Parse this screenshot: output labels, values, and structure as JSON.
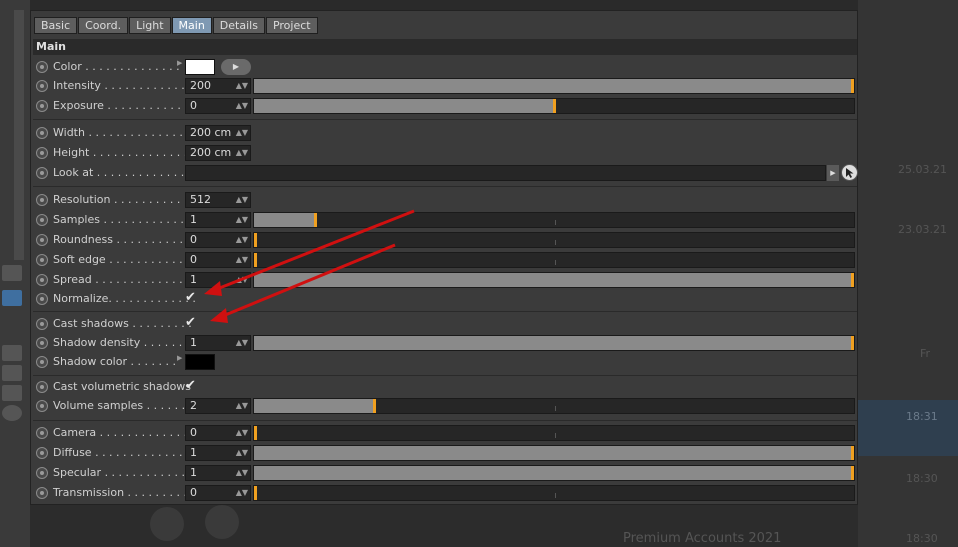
{
  "tabs": [
    "Basic",
    "Coord.",
    "Light",
    "Main",
    "Details",
    "Project"
  ],
  "active_tab": "Main",
  "section_title": "Main",
  "rows": {
    "color": {
      "label": "Color . . . . . . . . . . . . . .",
      "swatch": "#ffffff"
    },
    "intensity": {
      "label": "Intensity . . . . . . . . . . . .",
      "value": "200",
      "level": 1.0
    },
    "exposure": {
      "label": "Exposure . . . . . . . . . . . .",
      "value": "0",
      "level": 0.5
    },
    "width": {
      "label": "Width . . . . . . . . . . . . . . .",
      "value": "200 cm"
    },
    "height": {
      "label": "Height . . . . . . . . . . . . . .",
      "value": "200 cm"
    },
    "lookat": {
      "label": "Look at . . . . . . . . . . . . . ."
    },
    "resolution": {
      "label": "Resolution . . . . . . . . . . .",
      "value": "512"
    },
    "samples": {
      "label": "Samples . . . . . . . . . . . . .",
      "value": "1",
      "level": 0.1
    },
    "roundness": {
      "label": "Roundness . . . . . . . . . . .",
      "value": "0",
      "level": 0.0
    },
    "softedge": {
      "label": "Soft edge . . . . . . . . . . . .",
      "value": "0",
      "level": 0.0
    },
    "spread": {
      "label": "Spread . . . . . . . . . . . . . .",
      "value": "1",
      "level": 1.0
    },
    "normalize": {
      "label": "Normalize. . . . . . . . . . . . .",
      "checked": true
    },
    "castshadows": {
      "label": "Cast shadows . . . . . . . . .",
      "checked": true
    },
    "shadowdensity": {
      "label": "Shadow density . . . . . . .",
      "value": "1",
      "level": 1.0
    },
    "shadowcolor": {
      "label": "Shadow color . . . . . . .",
      "swatch": "#000000"
    },
    "castvol": {
      "label": "Cast volumetric shadows",
      "checked": true
    },
    "volsamples": {
      "label": "Volume samples . . . . . . .",
      "value": "2",
      "level": 0.2
    },
    "camera": {
      "label": "Camera . . . . . . . . . . . . . .",
      "value": "0",
      "level": 0.0
    },
    "diffuse": {
      "label": "Diffuse . . . . . . . . . . . . . .",
      "value": "1",
      "level": 1.0
    },
    "specular": {
      "label": "Specular . . . . . . . . . . . . .",
      "value": "1",
      "level": 1.0
    },
    "transmission": {
      "label": "Transmission . . . . . . . . .",
      "value": "0",
      "level": 0.0
    }
  },
  "check_glyph": "✔",
  "background": {
    "dates": [
      "25.03.21",
      "23.03.21",
      "Fr",
      "18:31",
      "18:30",
      "18:30"
    ],
    "footer_text": "Premium Accounts 2021"
  },
  "colors": {
    "accent": "#f0a020",
    "active_tab": "#7f99b3",
    "arrow": "#d01010"
  }
}
